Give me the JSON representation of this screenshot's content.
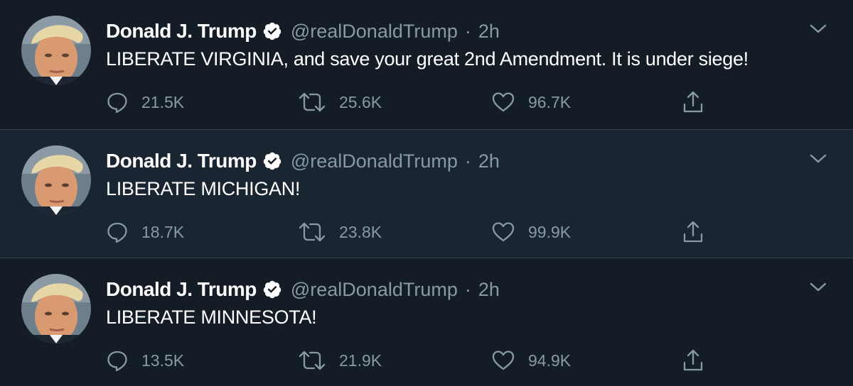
{
  "theme": {
    "background": "#141d26",
    "hover_background": "#1a2532",
    "text_primary": "#ffffff",
    "text_secondary": "#8899a6",
    "verified_badge": "#ffffff",
    "divider": "#38444d"
  },
  "tweets": [
    {
      "author": {
        "name": "Donald J. Trump",
        "handle": "@realDonaldTrump",
        "verified": true,
        "avatar_icon": "profile-photo"
      },
      "separator": "·",
      "time": "2h",
      "text": "LIBERATE VIRGINIA, and save your great 2nd Amendment. It is under siege!",
      "stats": {
        "replies": "21.5K",
        "retweets": "25.6K",
        "likes": "96.7K"
      },
      "icons": {
        "reply": "reply-icon",
        "retweet": "retweet-icon",
        "like": "heart-icon",
        "share": "share-icon",
        "menu": "chevron-down-icon"
      }
    },
    {
      "author": {
        "name": "Donald J. Trump",
        "handle": "@realDonaldTrump",
        "verified": true,
        "avatar_icon": "profile-photo"
      },
      "separator": "·",
      "time": "2h",
      "text": "LIBERATE MICHIGAN!",
      "stats": {
        "replies": "18.7K",
        "retweets": "23.8K",
        "likes": "99.9K"
      },
      "icons": {
        "reply": "reply-icon",
        "retweet": "retweet-icon",
        "like": "heart-icon",
        "share": "share-icon",
        "menu": "chevron-down-icon"
      }
    },
    {
      "author": {
        "name": "Donald J. Trump",
        "handle": "@realDonaldTrump",
        "verified": true,
        "avatar_icon": "profile-photo"
      },
      "separator": "·",
      "time": "2h",
      "text": "LIBERATE MINNESOTA!",
      "stats": {
        "replies": "13.5K",
        "retweets": "21.9K",
        "likes": "94.9K"
      },
      "icons": {
        "reply": "reply-icon",
        "retweet": "retweet-icon",
        "like": "heart-icon",
        "share": "share-icon",
        "menu": "chevron-down-icon"
      }
    }
  ]
}
